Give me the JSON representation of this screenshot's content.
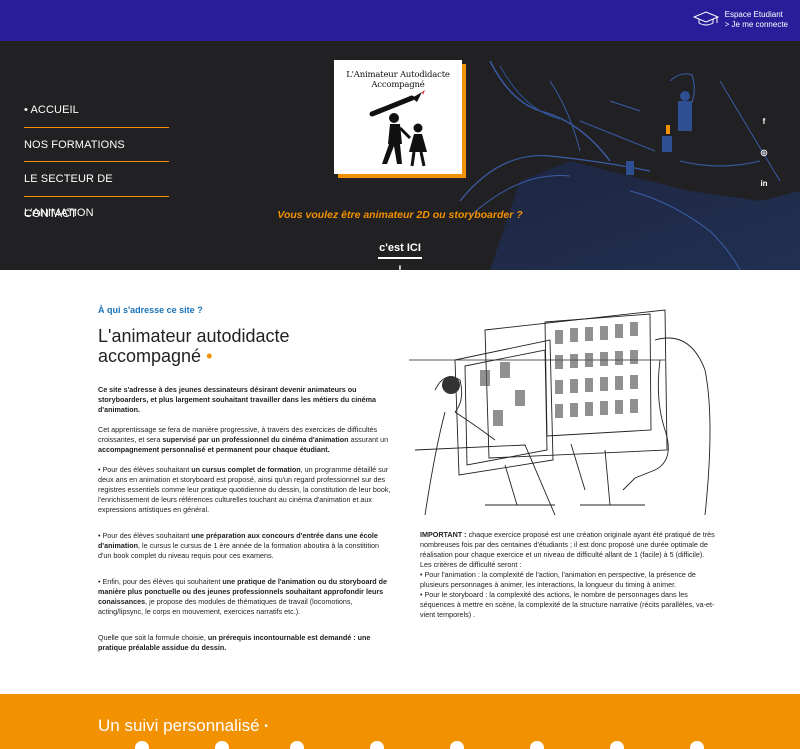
{
  "header": {
    "student_line1": "Espace Etudiant",
    "student_line2": "> Je me connecte",
    "logo_text": "L'Animateur Autodidacte Accompagné"
  },
  "nav": {
    "items": [
      {
        "label": "• ACCUEIL"
      },
      {
        "label": "NOS FORMATIONS"
      },
      {
        "label": "LE SECTEUR DE L'ANIMATION"
      },
      {
        "label": "CONTACT"
      }
    ]
  },
  "social": {
    "facebook": "f",
    "instagram": "◎",
    "linkedin": "in"
  },
  "hero": {
    "tagline": "Vous voulez être animateur 2D ou storyboarder ?",
    "cta": "c'est ICI !"
  },
  "intro": {
    "eyebrow": "À qui s'adresse ce site ?",
    "title": "L'animateur autodidacte accompagné",
    "title_dot": "•"
  },
  "body": {
    "p1_bold": "Ce site s'adresse à des jeunes dessinateurs désirant devenir animateurs ou storyboarders, et plus largement souhaitant travailler dans les métiers du cinéma d'animation.",
    "p2_a": "Cet apprentissage se fera de manière progressive, à travers des exercices de difficultés croissantes, et sera ",
    "p2_b": "supervisé par un professionnel du cinéma d'animation",
    "p2_c": " assurant un ",
    "p2_d": "accompagnement personnalisé et permanent pour chaque étudiant.",
    "p3_a": "• Pour des élèves souhaitant ",
    "p3_b": "un cursus complet de formation",
    "p3_c": ", un programme détaillé sur deux ans en animation et storyboard est proposé, ainsi qu'un regard professionnel sur des registres essentiels comme leur pratique quotidienne du dessin, la constitution de leur book, l'enrichissement de leurs références culturelles touchant au cinéma d'animation et aux expressions artistiques en général.",
    "p4_a": "• Pour des élèves souhaitant ",
    "p4_b": "une préparation aux concours d'entrée dans une école d'animation",
    "p4_c": ", le cursus le cursus de 1 ère année de la formation aboutira à la constitition d'un book complet du niveau requis pour ces examens.",
    "p5_a": "• Enfin, pour des élèves qui souhaitent ",
    "p5_b": "une pratique de l'animation ou du storyboard de manière plus ponctuelle ou des jeunes professionnels souhaitant approfondir leurs conaissances",
    "p5_c": ", je propose des modules de thématiques de travail (locomotions, acting/lipsync, le corps en mouvement, exercices narratifs etc.).",
    "p6_a": "Quelle que soit la formule choisie, ",
    "p6_b": "un prérequis incontournable est demandé : une pratique préalable assidue du dessin."
  },
  "important": {
    "label": "IMPORTANT :",
    "text": " chaque exercice proposé est une création originale ayant été pratiqué de très nombreuses fois par des centaines d'étudiants ; il est donc proposé une durée optimale de réalisation pour chaque exercice et un niveau de difficulté allant de 1 (facile) à 5 (difficile). Les critères de difficulté seront :",
    "bullet1": "• Pour l'animation : la complexité de l'action, l'animation en perspective, la présence de plusieurs personnages à animer, les interactions, la longueur du timing à animer.",
    "bullet2": "• Pour le storyboard : la complexité des actions, le nombre de personnages dans les séquences à mettre en scène, la complexité de la structure narrative (récits parallèles, va-et-vient temporels) ."
  },
  "followup": {
    "title": "Un suivi personnalisé",
    "dot": "•"
  },
  "colors": {
    "purple": "#2a1d9a",
    "orange": "#f39200",
    "dark": "#212023",
    "blue": "#1a73b8"
  }
}
